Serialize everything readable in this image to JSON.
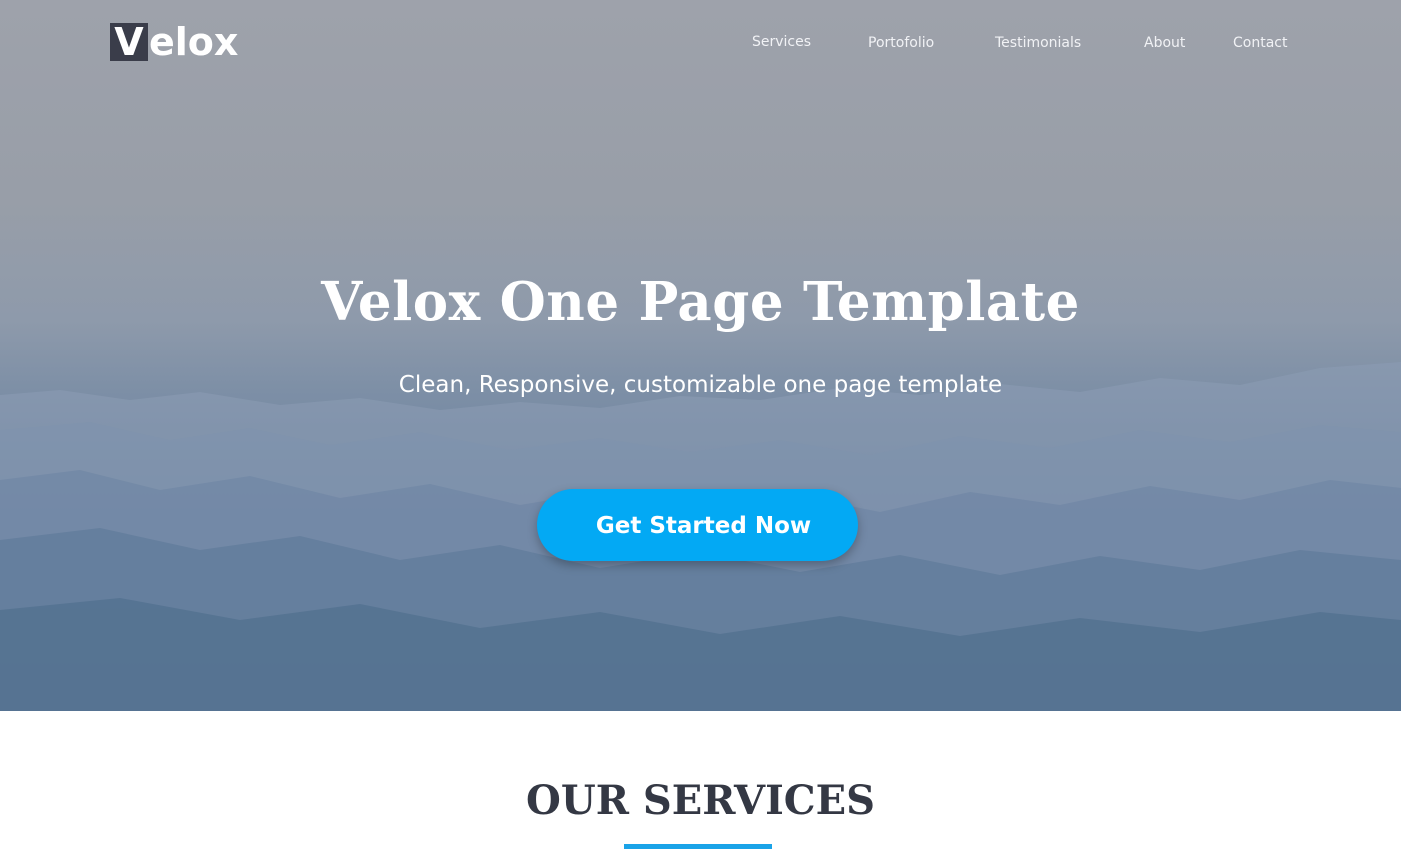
{
  "header": {
    "logo": {
      "first_letter": "V",
      "rest": "elox"
    },
    "nav": [
      {
        "label": "Services"
      },
      {
        "label": "Portofolio"
      },
      {
        "label": "Testimonials"
      },
      {
        "label": "About"
      },
      {
        "label": "Contact"
      }
    ]
  },
  "hero": {
    "title": "Velox One Page Template",
    "subtitle": "Clean, Responsive, customizable one page template",
    "cta_label": "Get Started Now",
    "cta_color": "#03a9f4"
  },
  "services": {
    "title": "OUR SERVICES",
    "accent_color": "#1aa3e8"
  }
}
